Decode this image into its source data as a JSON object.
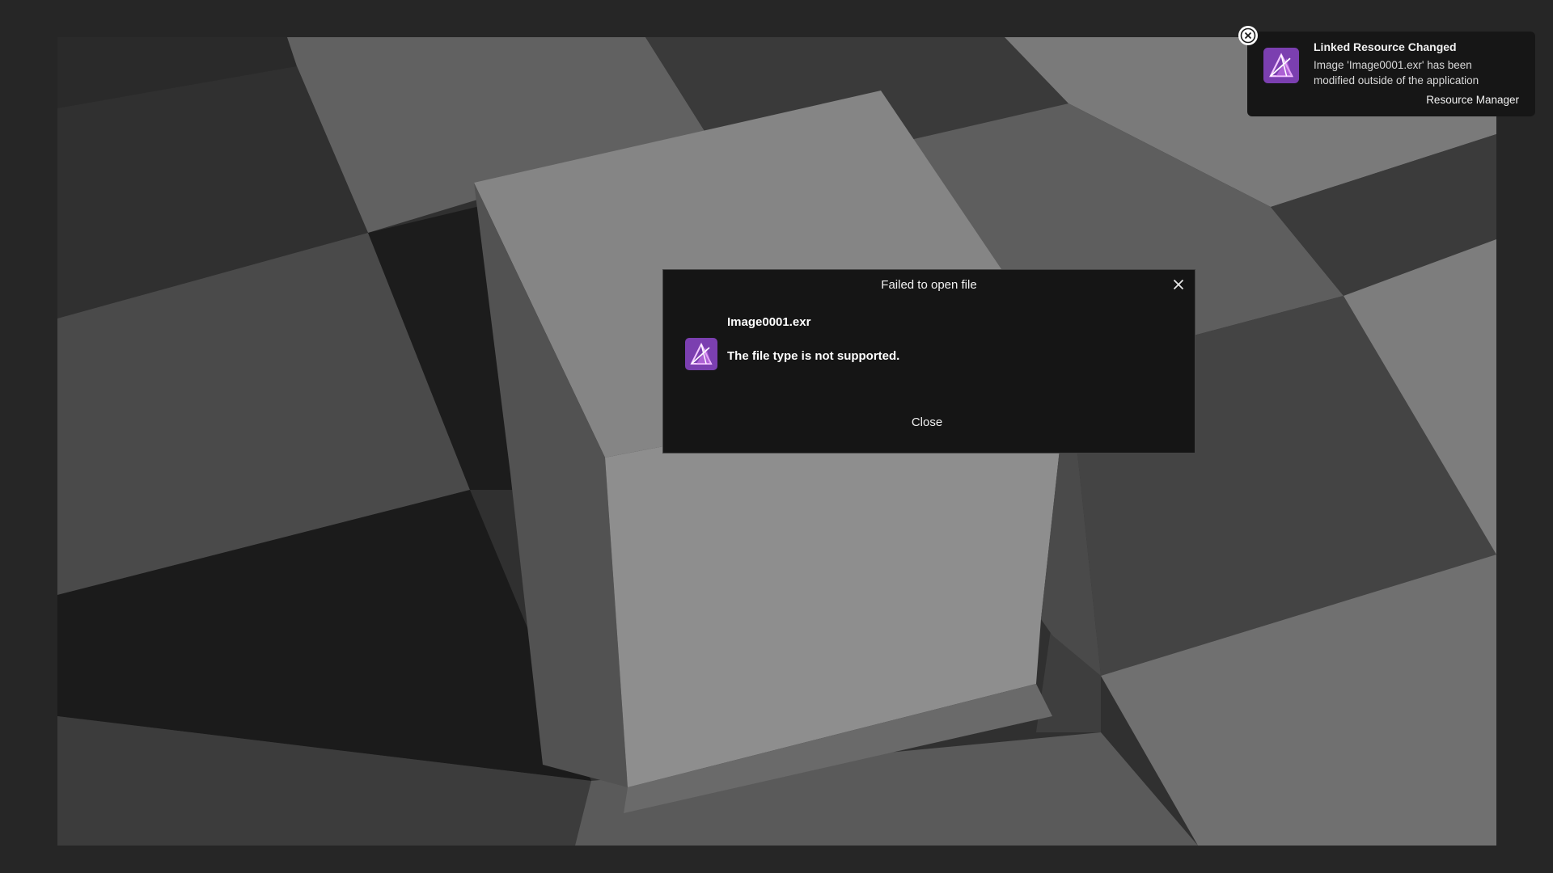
{
  "dialog": {
    "title": "Failed to open file",
    "close_icon": "close-x-icon",
    "app_icon": "affinity-photo-icon",
    "filename": "Image0001.exr",
    "message": "The file type is not supported.",
    "button_label": "Close"
  },
  "notification": {
    "dismiss_icon": "circle-x-icon",
    "app_icon": "affinity-photo-icon",
    "title": "Linked Resource Changed",
    "body": "Image 'Image0001.exr' has been modified outside of the application",
    "action_label": "Resource Manager"
  },
  "colors": {
    "app_background": "#262626",
    "dialog_background": "#151515",
    "brand_purple": "#7b3fb0",
    "brand_pink": "#d67cf2"
  }
}
